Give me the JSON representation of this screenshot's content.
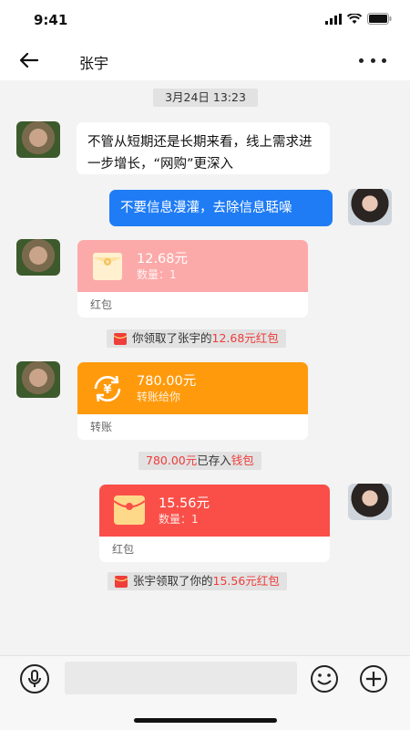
{
  "status_bar": {
    "time": "9:41"
  },
  "navbar": {
    "title": "张宇"
  },
  "timestamp": "3月24日 13:23",
  "messages": {
    "m1": "不管从短期还是长期来看，线上需求进一步增长，“网购”更深入",
    "m2": "不要信息漫灌，去除信息聒噪"
  },
  "red_packet_1": {
    "amount": "12.68元",
    "sub": "数量：1",
    "footer": "红包"
  },
  "notice_1": {
    "pre": "你领取了张宇的",
    "highlight": "12.68元红包"
  },
  "transfer": {
    "amount": "780.00元",
    "sub": "转账给你",
    "footer": "转账"
  },
  "notice_2": {
    "amount": "780.00元",
    "mid": "已存入",
    "wallet": "钱包"
  },
  "red_packet_2": {
    "amount": "15.56元",
    "sub": "数量：1",
    "footer": "红包"
  },
  "notice_3": {
    "pre": "张宇领取了你的",
    "highlight": "15.56元红包"
  },
  "input": {
    "value": ""
  },
  "colors": {
    "accent_blue": "#1f7cf5",
    "red_packet_received": "#fcaaa9",
    "transfer_orange": "#ff9a0c",
    "red_packet_sent": "#fa4f48",
    "highlight_red": "#ee3d3b"
  },
  "icons": [
    "back-arrow-icon",
    "more-dots-icon",
    "signal-icon",
    "wifi-icon",
    "battery-icon",
    "red-envelope-icon",
    "transfer-yen-icon",
    "mic-icon",
    "emoji-icon",
    "plus-icon"
  ]
}
